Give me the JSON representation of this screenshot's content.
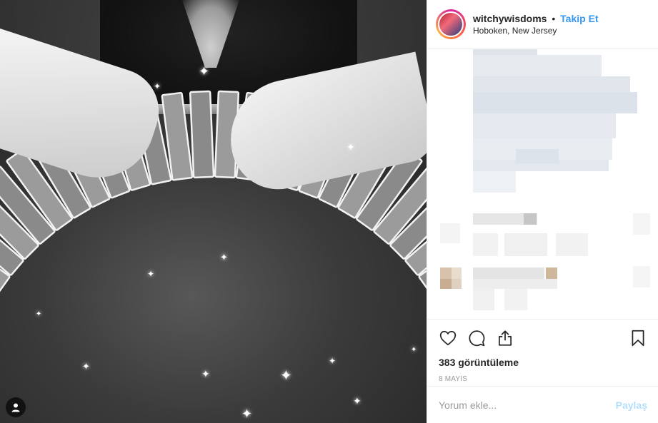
{
  "post": {
    "username": "witchywisdoms",
    "separator": "•",
    "follow_label": "Takip Et",
    "location": "Hoboken, New Jersey",
    "views_count": "383",
    "views_label": "görüntüleme",
    "date": "8 MAYIS"
  },
  "comment_box": {
    "placeholder": "Yorum ekle...",
    "post_label": "Paylaş"
  },
  "icons": {
    "like": "heart-icon",
    "comment": "speech-bubble-icon",
    "share": "share-icon",
    "save": "bookmark-icon",
    "tagged_user": "user-icon"
  },
  "colors": {
    "link_blue": "#3897f0",
    "disabled_blue": "#b2dffc",
    "text": "#262626",
    "muted": "#999999",
    "border": "#efefef"
  }
}
